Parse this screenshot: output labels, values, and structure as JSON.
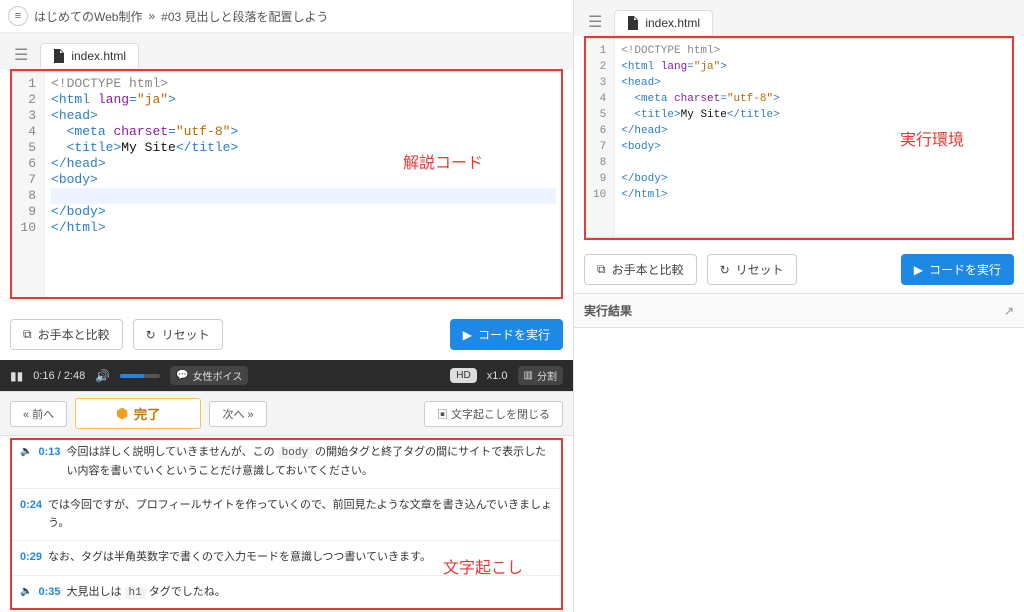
{
  "breadcrumb": {
    "course": "はじめてのWeb制作",
    "sep": "»",
    "lesson": "#03 見出しと段落を配置しよう"
  },
  "file_tab": "index.html",
  "annotations": {
    "left_label": "解説コード",
    "right_label": "実行環境",
    "transcript_label": "文字起こし"
  },
  "code_lines": {
    "l1": "<!DOCTYPE html>",
    "l2a": "html",
    "l2b": "lang",
    "l2c": "\"ja\"",
    "l3": "head",
    "l4a": "meta",
    "l4b": "charset",
    "l4c": "\"utf-8\"",
    "l5a": "title",
    "l5b": "My Site",
    "l5c": "/title",
    "l6": "/head",
    "l7": "body",
    "l9": "/body",
    "l10": "/html"
  },
  "toolbar": {
    "compare": "お手本と比較",
    "reset": "リセット",
    "run": "コードを実行"
  },
  "video": {
    "time_cur": "0:16",
    "time_total": "2:48",
    "voice_btn": "女性ボイス",
    "hd": "HD",
    "speed": "x1.0",
    "split": "分割"
  },
  "nav": {
    "prev": "« 前へ",
    "done": "完了",
    "next": "次へ »",
    "close_tr": "文字起こしを閉じる"
  },
  "transcript": [
    {
      "t": "0:13",
      "text_a": "今回は詳しく説明していきませんが、この ",
      "code": "body",
      "text_b": " の開始タグと終了タグの間にサイトで表示したい内容を書いていくということだけ意識しておいてください。"
    },
    {
      "t": "0:24",
      "text_a": "では今回ですが、プロフィールサイトを作っていくので、前回見たような文章を書き込んでいきましょう。",
      "code": "",
      "text_b": ""
    },
    {
      "t": "0:29",
      "text_a": "なお、タグは半角英数字で書くので入力モードを意識しつつ書いていきます。",
      "code": "",
      "text_b": ""
    },
    {
      "t": "0:35",
      "text_a": "大見出しは ",
      "code": "h1",
      "text_b": " タグでしたね。"
    }
  ],
  "right": {
    "result_header": "実行結果"
  }
}
